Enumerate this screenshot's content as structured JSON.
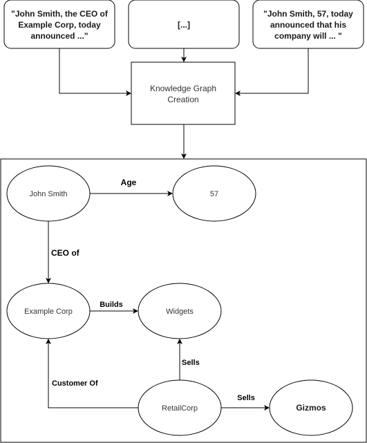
{
  "sources": [
    {
      "id": "source-1",
      "lines": [
        "\"John Smith, the CEO of",
        "Example Corp, today",
        "announced ...\""
      ]
    },
    {
      "id": "source-2",
      "lines": [
        "[...]"
      ]
    },
    {
      "id": "source-3",
      "lines": [
        "\"John Smith, 57, today",
        "announced that his",
        "company will ... \""
      ]
    }
  ],
  "process": {
    "lines": [
      "Knowledge Graph",
      "Creation"
    ]
  },
  "graph": {
    "nodes": {
      "john_smith": "John Smith",
      "age_57": "57",
      "example_corp": "Example Corp",
      "widgets": "Widgets",
      "retailcorp": "RetailCorp",
      "gizmos": "Gizmos"
    },
    "edges": {
      "age": "Age",
      "ceo_of": "CEO of",
      "builds": "Builds",
      "sells_widgets": "Sells",
      "customer_of": "Customer Of",
      "sells_gizmos": "Sells"
    }
  }
}
